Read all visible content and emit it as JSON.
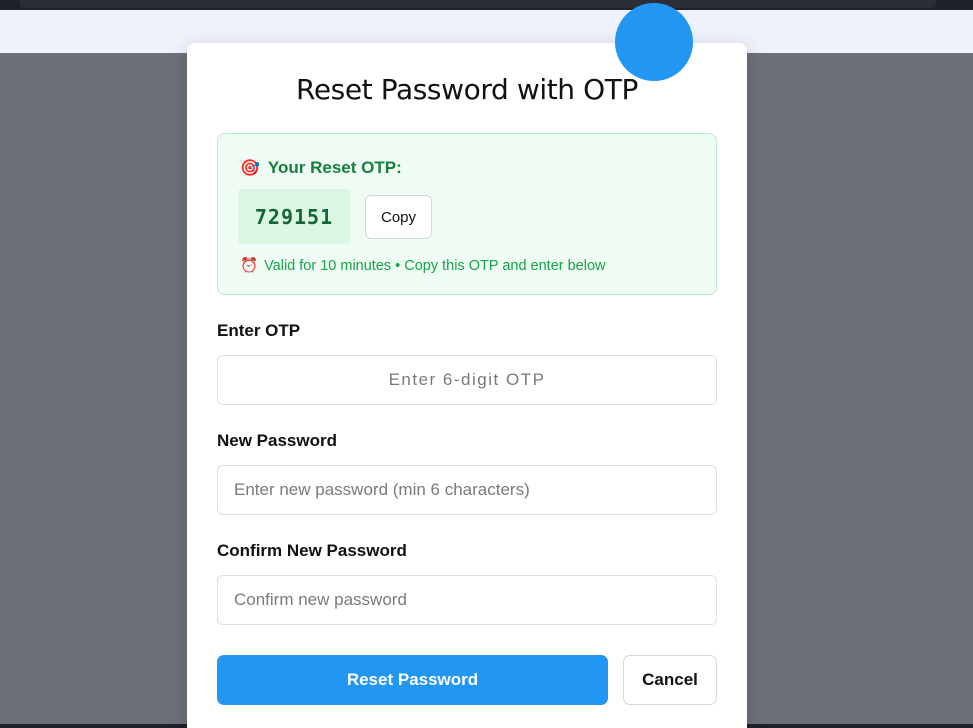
{
  "modal": {
    "title": "Reset Password with OTP"
  },
  "otp_panel": {
    "heading_icon": "target-icon",
    "heading": "Your Reset OTP:",
    "code": "729151",
    "copy_label": "Copy",
    "note_icon": "alarm-clock-icon",
    "note": "Valid for 10 minutes • Copy this OTP and enter below"
  },
  "fields": {
    "otp": {
      "label": "Enter OTP",
      "placeholder": "Enter 6-digit OTP",
      "value": ""
    },
    "new_password": {
      "label": "New Password",
      "placeholder": "Enter new password (min 6 characters)",
      "value": ""
    },
    "confirm_password": {
      "label": "Confirm New Password",
      "placeholder": "Confirm new password",
      "value": ""
    }
  },
  "actions": {
    "reset_label": "Reset Password",
    "cancel_label": "Cancel"
  },
  "colors": {
    "primary": "#2196f3",
    "success_text": "#15803d",
    "success_bg": "#effcf3",
    "backdrop": "#6d7079"
  }
}
